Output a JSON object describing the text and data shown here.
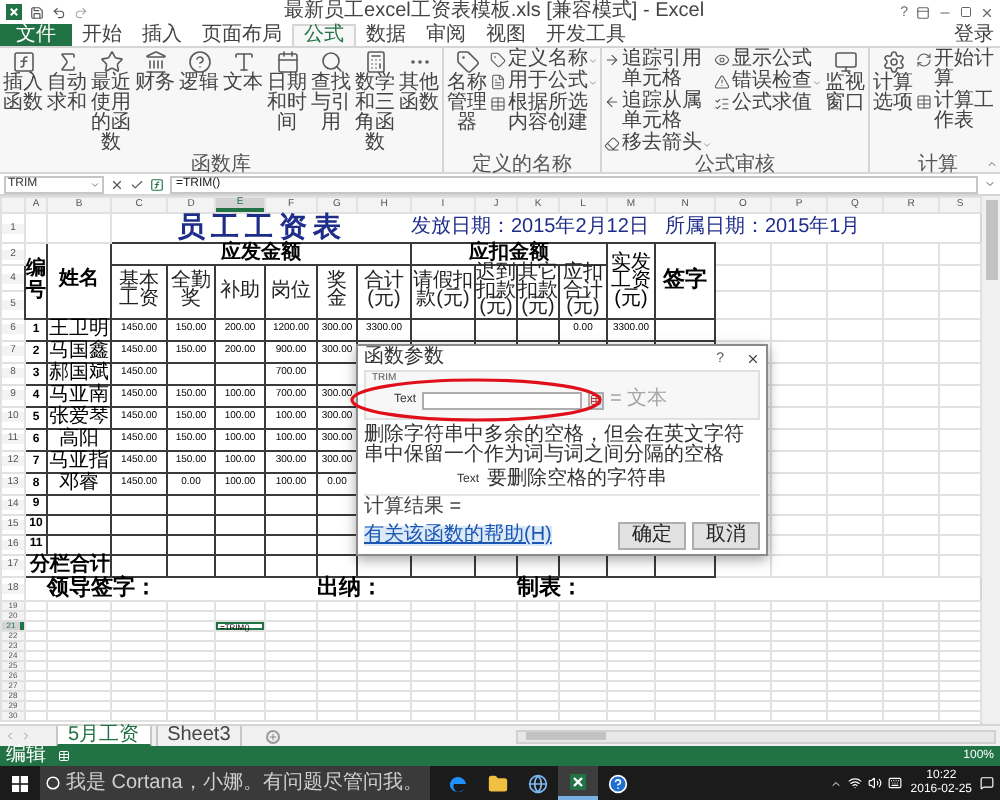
{
  "window": {
    "title": "最新员工excel工资表模板.xls [兼容模式] - Excel",
    "help": "?"
  },
  "tabs": [
    {
      "label": "文件",
      "kind": "file",
      "selected": false
    },
    {
      "label": "开始",
      "kind": "tab",
      "selected": false
    },
    {
      "label": "插入",
      "kind": "tab",
      "selected": false
    },
    {
      "label": "页面布局",
      "kind": "tab",
      "selected": false
    },
    {
      "label": "公式",
      "kind": "tab",
      "selected": true
    },
    {
      "label": "数据",
      "kind": "tab",
      "selected": false
    },
    {
      "label": "审阅",
      "kind": "tab",
      "selected": false
    },
    {
      "label": "视图",
      "kind": "tab",
      "selected": false
    },
    {
      "label": "开发工具",
      "kind": "tab",
      "selected": false
    }
  ],
  "account": "登录",
  "ribbon": [
    {
      "label": "函数库",
      "items": [
        {
          "kind": "large",
          "label": "插入函数"
        },
        {
          "kind": "large",
          "label": "自动求和"
        },
        {
          "kind": "large",
          "label": "最近使用的函数"
        },
        {
          "kind": "large",
          "label": "财务"
        },
        {
          "kind": "large",
          "label": "逻辑"
        },
        {
          "kind": "large",
          "label": "文本"
        },
        {
          "kind": "large",
          "label": "日期和时间"
        },
        {
          "kind": "large",
          "label": "查找与引用"
        },
        {
          "kind": "large",
          "label": "数学和三角函数"
        },
        {
          "kind": "large",
          "label": "其他函数"
        }
      ]
    },
    {
      "label": "定义的名称",
      "items": [
        {
          "kind": "large",
          "label": "名称管理器"
        },
        {
          "kind": "stack",
          "items": [
            {
              "label": "定义名称",
              "dropdown": true
            },
            {
              "label": "用于公式",
              "dropdown": true
            },
            {
              "label": "根据所选内容创建",
              "dropdown": false
            }
          ]
        }
      ]
    },
    {
      "label": "公式审核",
      "items": [
        {
          "kind": "stack",
          "items": [
            {
              "label": "追踪引用单元格",
              "dropdown": false
            },
            {
              "label": "追踪从属单元格",
              "dropdown": false
            },
            {
              "label": "移去箭头",
              "dropdown": true
            }
          ]
        },
        {
          "kind": "stack",
          "items": [
            {
              "label": "显示公式",
              "dropdown": false
            },
            {
              "label": "错误检查",
              "dropdown": true
            },
            {
              "label": "公式求值",
              "dropdown": false
            }
          ]
        },
        {
          "kind": "large",
          "label": "监视窗口"
        }
      ]
    },
    {
      "label": "计算",
      "items": [
        {
          "kind": "large",
          "label": "计算选项"
        },
        {
          "kind": "stack",
          "items": [
            {
              "label": "开始计算",
              "dropdown": false
            },
            {
              "label": "计算工作表",
              "dropdown": false
            }
          ]
        }
      ]
    }
  ],
  "formula_bar": {
    "name_box": "TRIM",
    "formula": "=TRIM()"
  },
  "sheet": {
    "columns": [
      {
        "label": "A",
        "selected": false
      },
      {
        "label": "B",
        "selected": false
      },
      {
        "label": "C",
        "selected": false
      },
      {
        "label": "D",
        "selected": false
      },
      {
        "label": "E",
        "selected": true
      },
      {
        "label": "F",
        "selected": false
      },
      {
        "label": "G",
        "selected": false
      },
      {
        "label": "H",
        "selected": false
      },
      {
        "label": "I",
        "selected": false
      },
      {
        "label": "J",
        "selected": false
      },
      {
        "label": "K",
        "selected": false
      },
      {
        "label": "L",
        "selected": false
      },
      {
        "label": "M",
        "selected": false
      },
      {
        "label": "N",
        "selected": false
      },
      {
        "label": "O",
        "selected": false
      },
      {
        "label": "P",
        "selected": false
      },
      {
        "label": "Q",
        "selected": false
      },
      {
        "label": "R",
        "selected": false
      },
      {
        "label": "S",
        "selected": false
      }
    ],
    "title": "员工工资表",
    "issue_date": "发放日期：2015年2月12日",
    "period": "所属日期：2015年1月",
    "id_header": "编号",
    "name_header": "姓名",
    "earnings_group": "应发金额",
    "deductions_group": "应扣金额",
    "earnings_headers": [
      "基本工资",
      "全勤奖",
      "补助",
      "岗位",
      "奖金",
      "合计(元)"
    ],
    "deduction_headers": [
      "请假扣款(元)",
      "迟到扣款(元)",
      "其它扣款(元)",
      "应扣合计(元)"
    ],
    "net_header": "实发工资(元)",
    "sign_header": "签字",
    "rows": [
      {
        "kind": "title",
        "label": "1",
        "selected": false
      },
      {
        "kind": "group_header",
        "label": "2",
        "selected": false
      },
      {
        "kind": "header",
        "label": "4",
        "selected": false
      },
      {
        "kind": "header_end",
        "label": "5",
        "selected": false
      },
      {
        "kind": "data",
        "label": "6",
        "selected": false,
        "id": "1",
        "name": "王卫明",
        "basic": "1450.00",
        "attendance": "150.00",
        "allowance": "200.00",
        "post": "1200.00",
        "bonus": "300.00",
        "total": "3300.00",
        "deduction_total": "0.00",
        "net_pay": "3300.00"
      },
      {
        "kind": "data",
        "label": "7",
        "selected": false,
        "id": "2",
        "name": "马国鑫",
        "basic": "1450.00",
        "attendance": "150.00",
        "allowance": "200.00",
        "post": "900.00",
        "bonus": "300.00"
      },
      {
        "kind": "data",
        "label": "8",
        "selected": false,
        "id": "3",
        "name": "郝国斌",
        "basic": "1450.00",
        "post": "700.00"
      },
      {
        "kind": "data",
        "label": "9",
        "selected": false,
        "id": "4",
        "name": "马亚南",
        "basic": "1450.00",
        "attendance": "150.00",
        "allowance": "100.00",
        "post": "700.00",
        "bonus": "300.00"
      },
      {
        "kind": "data",
        "label": "10",
        "selected": false,
        "id": "5",
        "name": "张爱琴",
        "basic": "1450.00",
        "attendance": "150.00",
        "allowance": "100.00",
        "post": "100.00",
        "bonus": "300.00"
      },
      {
        "kind": "data",
        "label": "11",
        "selected": false,
        "id": "6",
        "name": "高阳",
        "basic": "1450.00",
        "attendance": "150.00",
        "allowance": "100.00",
        "post": "100.00",
        "bonus": "300.00"
      },
      {
        "kind": "data",
        "label": "12",
        "selected": false,
        "id": "7",
        "name": "马亚指",
        "basic": "1450.00",
        "attendance": "150.00",
        "allowance": "100.00",
        "post": "300.00",
        "bonus": "300.00"
      },
      {
        "kind": "data",
        "label": "13",
        "selected": false,
        "id": "8",
        "name": "邓睿",
        "basic": "1450.00",
        "attendance": "0.00",
        "allowance": "100.00",
        "post": "100.00",
        "bonus": "0.00"
      },
      {
        "kind": "data",
        "label": "14",
        "selected": false,
        "id": "9"
      },
      {
        "kind": "data",
        "label": "15",
        "selected": false,
        "id": "10"
      },
      {
        "kind": "data",
        "label": "16",
        "selected": false,
        "id": "11"
      },
      {
        "kind": "subtotal",
        "label": "17",
        "selected": false,
        "text": "分栏合计"
      },
      {
        "kind": "signature",
        "label": "18",
        "selected": false,
        "texts": [
          "领导签字：",
          "出纳：",
          "制表："
        ]
      },
      {
        "kind": "blank",
        "label": "19",
        "selected": false
      },
      {
        "kind": "blank",
        "label": "20",
        "selected": false
      },
      {
        "kind": "blank",
        "label": "21",
        "selected": true,
        "active_value": "=TRIM()"
      },
      {
        "kind": "blank",
        "label": "22",
        "selected": false
      },
      {
        "kind": "blank",
        "label": "23",
        "selected": false
      },
      {
        "kind": "blank",
        "label": "24",
        "selected": false
      },
      {
        "kind": "blank",
        "label": "25",
        "selected": false
      },
      {
        "kind": "blank",
        "label": "26",
        "selected": false
      },
      {
        "kind": "blank",
        "label": "27",
        "selected": false
      },
      {
        "kind": "blank",
        "label": "28",
        "selected": false
      },
      {
        "kind": "blank",
        "label": "29",
        "selected": false
      },
      {
        "kind": "blank",
        "label": "30",
        "selected": false
      }
    ]
  },
  "dialog": {
    "title": "函数参数",
    "help": "?",
    "function_name": "TRIM",
    "argument_label": "Text",
    "argument_result": "= 文本",
    "description": "删除字符串中多余的空格，但会在英文字符串中保留一个作为词与词之间分隔的空格",
    "argument_name": "Text",
    "argument_help": "要删除空格的字符串",
    "result_label": "计算结果 =",
    "help_link": "有关该函数的帮助(H)",
    "buttons": [
      "确定",
      "取消"
    ]
  },
  "sheet_tabs": [
    {
      "label": "5月工资",
      "selected": true
    },
    {
      "label": "Sheet3",
      "selected": false
    }
  ],
  "status_bar": {
    "mode": "编辑",
    "zoom": "100%"
  },
  "taskbar": {
    "search_placeholder": "我是 Cortana，小娜。有问题尽管问我。",
    "apps": [
      {
        "kind": "browser",
        "selected": false
      },
      {
        "kind": "folder",
        "selected": false
      },
      {
        "kind": "globe",
        "selected": false
      },
      {
        "kind": "excel",
        "selected": true
      },
      {
        "kind": "help",
        "selected": false
      }
    ],
    "time": "10:22",
    "date": "2016-02-25"
  }
}
